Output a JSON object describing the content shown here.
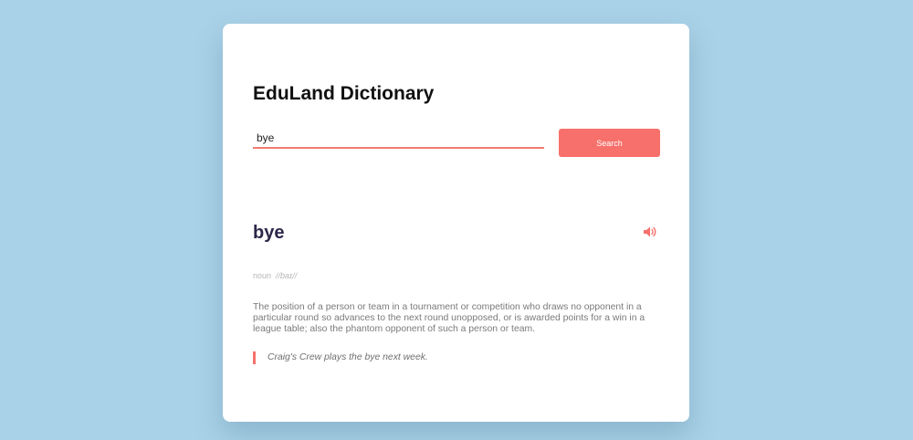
{
  "app": {
    "title": "EduLand Dictionary"
  },
  "search": {
    "value": "bye",
    "placeholder": "",
    "button_label": "Search"
  },
  "result": {
    "word": "bye",
    "part_of_speech": "noun",
    "phonetic": "//baɪ//",
    "definition": "The position of a person or team in a tournament or competition who draws no opponent in a particular round so advances to the next round unopposed, or is awarded points for a win in a league table; also the phantom opponent of such a person or team.",
    "example": "Craig's Crew plays the bye next week.",
    "pronounce_icon": "speaker-volume-icon"
  },
  "colors": {
    "background": "#a9d1e7",
    "accent": "#f7706b",
    "word": "#2c2749"
  }
}
